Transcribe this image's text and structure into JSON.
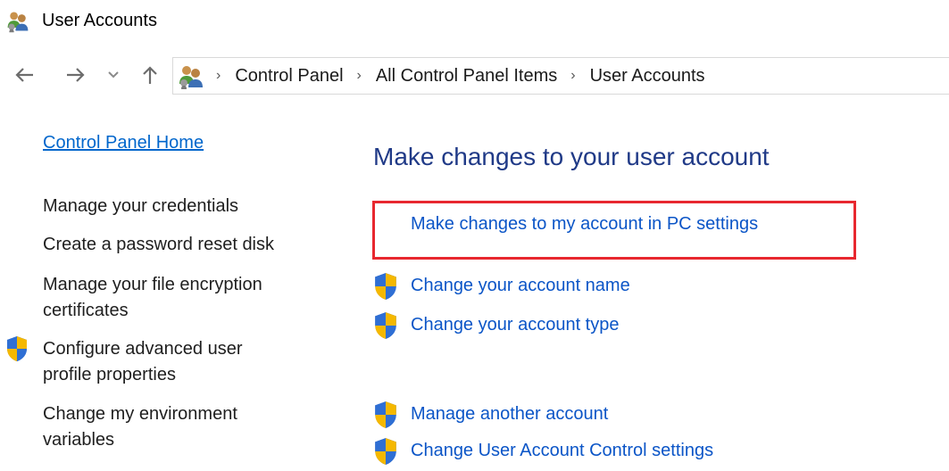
{
  "window": {
    "title": "User Accounts",
    "icon": "users-icon"
  },
  "nav": {
    "back_icon": "arrow-left-icon",
    "forward_icon": "arrow-right-icon",
    "recent_icon": "chevron-down-icon",
    "up_icon": "arrow-up-icon"
  },
  "breadcrumb": {
    "icon": "users-icon",
    "items": [
      "Control Panel",
      "All Control Panel Items",
      "User Accounts"
    ]
  },
  "sidebar": {
    "home_link": "Control Panel Home",
    "tasks": [
      {
        "label": "Manage your credentials",
        "icon": ""
      },
      {
        "label": "Create a password reset disk",
        "icon": ""
      },
      {
        "label_lines": [
          "Manage your file encryption",
          "certificates"
        ],
        "icon": ""
      },
      {
        "label_lines": [
          "Configure advanced user",
          "profile properties"
        ],
        "icon": "uac-shield-icon"
      },
      {
        "label_lines": [
          "Change my environment",
          "variables"
        ],
        "icon": ""
      }
    ]
  },
  "main": {
    "heading": "Make changes to your user account",
    "highlight_color": "#e8282f",
    "links": [
      {
        "label": "Make changes to my account in PC settings",
        "icon": ""
      },
      {
        "label": "Change your account name",
        "icon": "uac-shield-icon"
      },
      {
        "label": "Change your account type",
        "icon": "uac-shield-icon"
      },
      {
        "label": "Manage another account",
        "icon": "uac-shield-icon"
      },
      {
        "label": "Change User Account Control settings",
        "icon": "uac-shield-icon"
      }
    ]
  },
  "colors": {
    "link": "#0b55c7",
    "heading": "#203a87",
    "home_link": "#0066cc"
  }
}
